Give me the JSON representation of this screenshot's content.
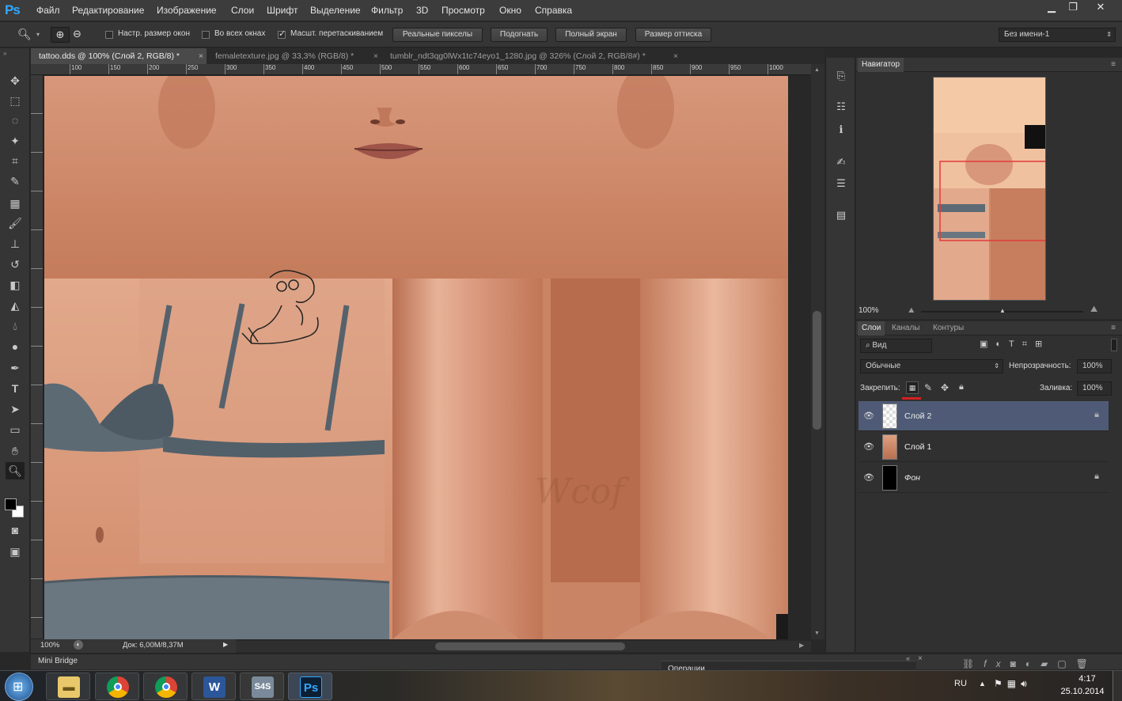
{
  "app": {
    "logo": "Ps"
  },
  "menu": [
    "Файл",
    "Редактирование",
    "Изображение",
    "Слои",
    "Шрифт",
    "Выделение",
    "Фильтр",
    "3D",
    "Просмотр",
    "Окно",
    "Справка"
  ],
  "options": {
    "resize_windows": "Настр. размер окон",
    "all_windows": "Во всех окнах",
    "scrubby_zoom": "Масшт. перетаскиванием",
    "btn_actual": "Реальные пикселы",
    "btn_fit": "Подогнать",
    "btn_fullscreen": "Полный экран",
    "btn_print": "Размер оттиска",
    "workspace": "Без имени-1"
  },
  "tabs": [
    "tattoo.dds @ 100% (Слой 2, RGB/8) *",
    "femaletexture.jpg @ 33,3% (RGB/8) *",
    "tumblr_ndt3qg0lWx1tc74eyo1_1280.jpg @ 326% (Слой 2, RGB/8#) *"
  ],
  "ruler": [
    "100",
    "150",
    "200",
    "250",
    "300",
    "350",
    "400",
    "450",
    "500",
    "550",
    "600",
    "650",
    "700",
    "750",
    "800",
    "850",
    "900",
    "950",
    "1000"
  ],
  "status": {
    "zoom": "100%",
    "doc": "Док: 6,00M/8,37M"
  },
  "canvas": {
    "watermark": "Wcof"
  },
  "bottom": {
    "mini_bridge": "Mini Bridge",
    "operations": "Операции"
  },
  "navigator": {
    "title": "Навигатор",
    "zoom": "100%"
  },
  "layers_panel": {
    "tabs": [
      "Слои",
      "Каналы",
      "Контуры"
    ],
    "filter": "Вид",
    "blend": "Обычные",
    "opacity_label": "Непрозрачность:",
    "opacity": "100%",
    "lock_label": "Закрепить:",
    "fill_label": "Заливка:",
    "fill": "100%",
    "layers": [
      {
        "name": "Слой 2",
        "selected": true,
        "locked": true
      },
      {
        "name": "Слой 1",
        "selected": false,
        "locked": false
      },
      {
        "name": "Фон",
        "selected": false,
        "locked": true
      }
    ]
  },
  "taskbar": {
    "lang": "RU",
    "time": "4:17",
    "date": "25.10.2014",
    "apps": [
      "explorer",
      "chrome",
      "chrome",
      "word",
      "s4s",
      "photoshop"
    ],
    "word_label": "W",
    "s4s_label": "S4S",
    "ps_label": "Ps"
  },
  "colors": {
    "skin": "#c98564",
    "bra": "#5a6872",
    "selected_layer": "#4f5b76",
    "ps_blue": "#31a8ff"
  }
}
